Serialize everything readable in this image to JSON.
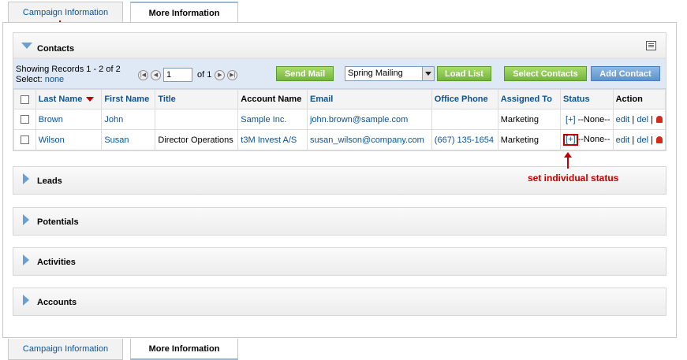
{
  "tabs": {
    "campaign_info": "Campaign Information",
    "more_info": "More Information"
  },
  "contacts": {
    "title": "Contacts",
    "records_text": "Showing Records 1 - 2 of 2",
    "select_label": "Select:",
    "select_none": "none",
    "page_value": "1",
    "page_of": "of 1",
    "send_mail": "Send Mail",
    "mailing_select": "Spring Mailing",
    "load_list": "Load List",
    "select_contacts": "Select Contacts",
    "add_contact": "Add Contact",
    "columns": [
      "Last Name",
      "First Name",
      "Title",
      "Account Name",
      "Email",
      "Office Phone",
      "Assigned To",
      "Status",
      "Action"
    ],
    "rows": [
      {
        "last_name": "Brown",
        "first_name": "John",
        "title": "",
        "account": "Sample Inc.",
        "email": "john.brown@sample.com",
        "phone": "",
        "assigned": "Marketing",
        "status_plus": "[+]",
        "status_value": "--None--",
        "edit": "edit",
        "del": "del"
      },
      {
        "last_name": "Wilson",
        "first_name": "Susan",
        "title": "Director Operations",
        "account": "t3M Invest A/S",
        "email": "susan_wilson@company.com",
        "phone": "(667) 135-1654",
        "assigned": "Marketing",
        "status_plus": "[+]",
        "status_value": "--None--",
        "edit": "edit",
        "del": "del"
      }
    ]
  },
  "panels": {
    "leads": "Leads",
    "potentials": "Potentials",
    "activities": "Activities",
    "accounts": "Accounts"
  },
  "annotation": {
    "text": "set individual status",
    "color": "#c00000"
  },
  "colors": {
    "link": "#0b5394",
    "green_button": "#74b53a",
    "blue_button": "#5d93cf",
    "toolbar_bg": "#dfe9f5"
  }
}
